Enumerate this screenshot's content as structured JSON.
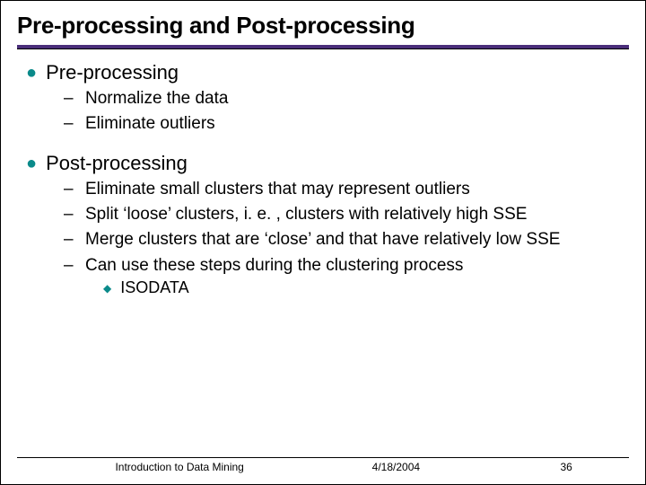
{
  "title": "Pre-processing and Post-processing",
  "sections": [
    {
      "heading": "Pre-processing",
      "items": [
        {
          "text": "Normalize the data"
        },
        {
          "text": "Eliminate outliers"
        }
      ]
    },
    {
      "heading": "Post-processing",
      "items": [
        {
          "text": "Eliminate small clusters that may represent outliers"
        },
        {
          "text": "Split ‘loose’ clusters, i. e. , clusters with relatively high SSE"
        },
        {
          "text": "Merge clusters that are ‘close’ and that have relatively low SSE"
        },
        {
          "text": "Can use these steps during the clustering process",
          "subitems": [
            {
              "text": "ISODATA"
            }
          ]
        }
      ]
    }
  ],
  "footer": {
    "left": "Introduction to Data Mining",
    "center": "4/18/2004",
    "right": "36"
  }
}
